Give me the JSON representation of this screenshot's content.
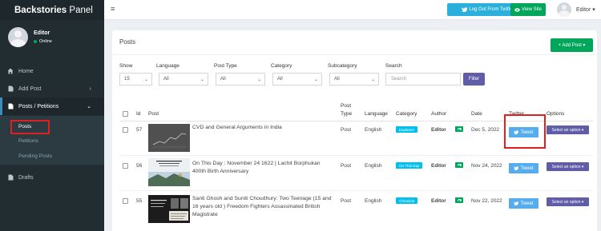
{
  "sidebar": {
    "brand_bold": "Backstories",
    "brand_light": "Panel",
    "user": {
      "name": "Editor",
      "status": "Online"
    },
    "menu": [
      {
        "label": "Home",
        "icon": "home-icon"
      },
      {
        "label": "Add Post",
        "icon": "file-icon",
        "chevron": "‹"
      },
      {
        "label": "Posts / Petitions",
        "icon": "file-icon",
        "chevron": "⌄"
      },
      {
        "label": "Drafts",
        "icon": "file-icon"
      }
    ],
    "submenu": [
      "Posts",
      "Petitions",
      "Pending Posts"
    ]
  },
  "header": {
    "menu_icon": "≡",
    "logout_twitter_label": "Log Out From Twitter",
    "view_site_label": "View Site",
    "user_label": "Editor ▾"
  },
  "panel": {
    "title": "Posts",
    "add_post_label": "+ Add Post ▾",
    "filters": {
      "show_label": "Show",
      "show_value": "15",
      "language_label": "Language",
      "language_value": "All",
      "post_type_label": "Post Type",
      "post_type_value": "All",
      "category_label": "Category",
      "category_value": "All",
      "subcategory_label": "Subcategory",
      "subcategory_value": "All",
      "search_label": "Search",
      "search_placeholder": "Search",
      "filter_label": "Filter"
    },
    "columns": {
      "id": "Id",
      "post": "Post",
      "post_type_1": "Post",
      "post_type_2": "Type",
      "language": "Language",
      "category": "Category",
      "author": "Author",
      "date": "Date",
      "twitter": "Twitter",
      "options": "Options"
    },
    "rows": [
      {
        "id": "57",
        "title": "CVD and General Arguments in India",
        "type": "Post",
        "language": "English",
        "category": "Explainer",
        "author": "Editor",
        "date": "Dec 5, 2022",
        "tweet": "Tweet",
        "options": "Select an option ▾"
      },
      {
        "id": "56",
        "title": "On This Day : November 24 1622 | Lachit Borphukan 400th Birth Anniversary",
        "type": "Post",
        "language": "English",
        "category": "On This Day",
        "author": "Editor",
        "date": "Nov 24, 2022",
        "tweet": "Tweet",
        "options": "Select an option ▾"
      },
      {
        "id": "55",
        "title": "Santi Ghosh and Suniti Choudhury: Two Teenage (15 and 16 years old ) Freedom Fighters Assassinated British Magistrate",
        "type": "Post",
        "language": "English",
        "category": "Chronicle",
        "author": "Editor",
        "date": "Nov 22, 2022",
        "tweet": "Tweet",
        "options": "Select an option ▾"
      }
    ]
  }
}
